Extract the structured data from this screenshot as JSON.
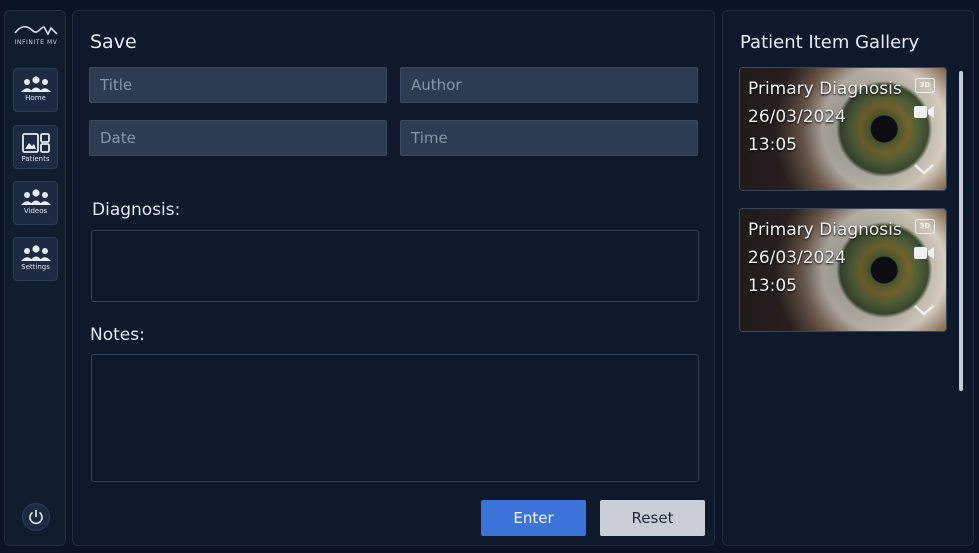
{
  "brand": {
    "logo_text": "INFINITE MV"
  },
  "sidebar": {
    "items": [
      {
        "label": "Home",
        "icon": "people-icon"
      },
      {
        "label": "Patients",
        "icon": "dashboard-icon"
      },
      {
        "label": "Videos",
        "icon": "people-icon"
      },
      {
        "label": "Settings",
        "icon": "people-icon"
      }
    ],
    "power_icon": "power-icon"
  },
  "form": {
    "title": "Save",
    "fields": {
      "title_placeholder": "Title",
      "author_placeholder": "Author",
      "date_placeholder": "Date",
      "time_placeholder": "Time"
    },
    "diagnosis_label": "Diagnosis:",
    "notes_label": "Notes:",
    "enter_label": "Enter",
    "reset_label": "Reset"
  },
  "gallery": {
    "title": "Patient Item Gallery",
    "items": [
      {
        "title": "Primary Diagnosis",
        "date": "26/03/2024",
        "time": "13:05",
        "badge": "3D"
      },
      {
        "title": "Primary Diagnosis",
        "date": "26/03/2024",
        "time": "13:05",
        "badge": "3D"
      }
    ]
  },
  "colors": {
    "accent": "#3b73d8",
    "background": "#0a1424",
    "panel": "#0e1a2b"
  }
}
